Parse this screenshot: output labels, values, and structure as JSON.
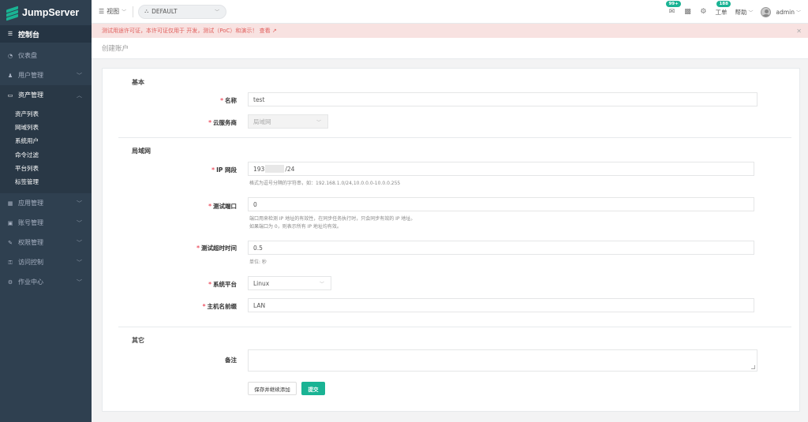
{
  "app": {
    "name": "JumpServer"
  },
  "colors": {
    "sidebar_bg": "#2f4050",
    "accent": "#1ab394",
    "alert_bg": "#f8e2e1",
    "alert_text": "#e05d5a",
    "required": "#ed5565"
  },
  "sidebar": {
    "home": {
      "label": "控制台",
      "icon": "dashboard-icon"
    },
    "items": [
      {
        "label": "仪表盘",
        "icon": "speedometer-icon",
        "has_children": false
      },
      {
        "label": "用户管理",
        "icon": "users-icon",
        "has_children": true
      },
      {
        "label": "资产管理",
        "icon": "inbox-icon",
        "has_children": true,
        "expanded": true
      },
      {
        "label": "应用管理",
        "icon": "grid-icon",
        "has_children": true
      },
      {
        "label": "账号管理",
        "icon": "id-card-icon",
        "has_children": true
      },
      {
        "label": "权限管理",
        "icon": "edit-icon",
        "has_children": true
      },
      {
        "label": "访问控制",
        "icon": "lock-icon",
        "has_children": true
      },
      {
        "label": "作业中心",
        "icon": "gear-icon",
        "has_children": true
      }
    ],
    "asset_sub_items": [
      "资产列表",
      "网域列表",
      "系统用户",
      "命令过滤",
      "平台列表",
      "标签管理"
    ]
  },
  "topbar": {
    "view_label": "视图",
    "org_label": "DEFAULT",
    "mail_badge": "99+",
    "ticket_badge": "188",
    "ticket_label": "工单",
    "help_label": "帮助",
    "user_label": "admin"
  },
  "alert": {
    "text": "测试用途许可证，本许可证仅用于 开发，测试（PoC）和演示！ 查看 ↗"
  },
  "page": {
    "title": "创建账户"
  },
  "form": {
    "section_basic": "基本",
    "name_label": "名称",
    "name_value": "test",
    "cloud_label": "云服务商",
    "cloud_value": "局域网",
    "section_lan": "局域网",
    "ip_label": "IP 网段",
    "ip_prefix": "193",
    "ip_suffix": "/24",
    "ip_help": "格式为逗号分隔的字符串，如：192.168.1.0/24,10.0.0.0-10.0.0.255",
    "port_label": "测试端口",
    "port_value": "0",
    "port_help_1": "端口用来检测 IP 地址的有效性，在同步任务执行时，只会同步有效的 IP 地址。",
    "port_help_2": "如果端口为 0，则表示所有 IP 地址均有效。",
    "timeout_label": "测试超时时间",
    "timeout_value": "0.5",
    "timeout_help": "单位: 秒",
    "platform_label": "系统平台",
    "platform_value": "Linux",
    "hostname_label": "主机名前缀",
    "hostname_value": "LAN",
    "section_other": "其它",
    "comment_label": "备注",
    "save_continue_label": "保存并继续添加",
    "submit_label": "提交"
  }
}
